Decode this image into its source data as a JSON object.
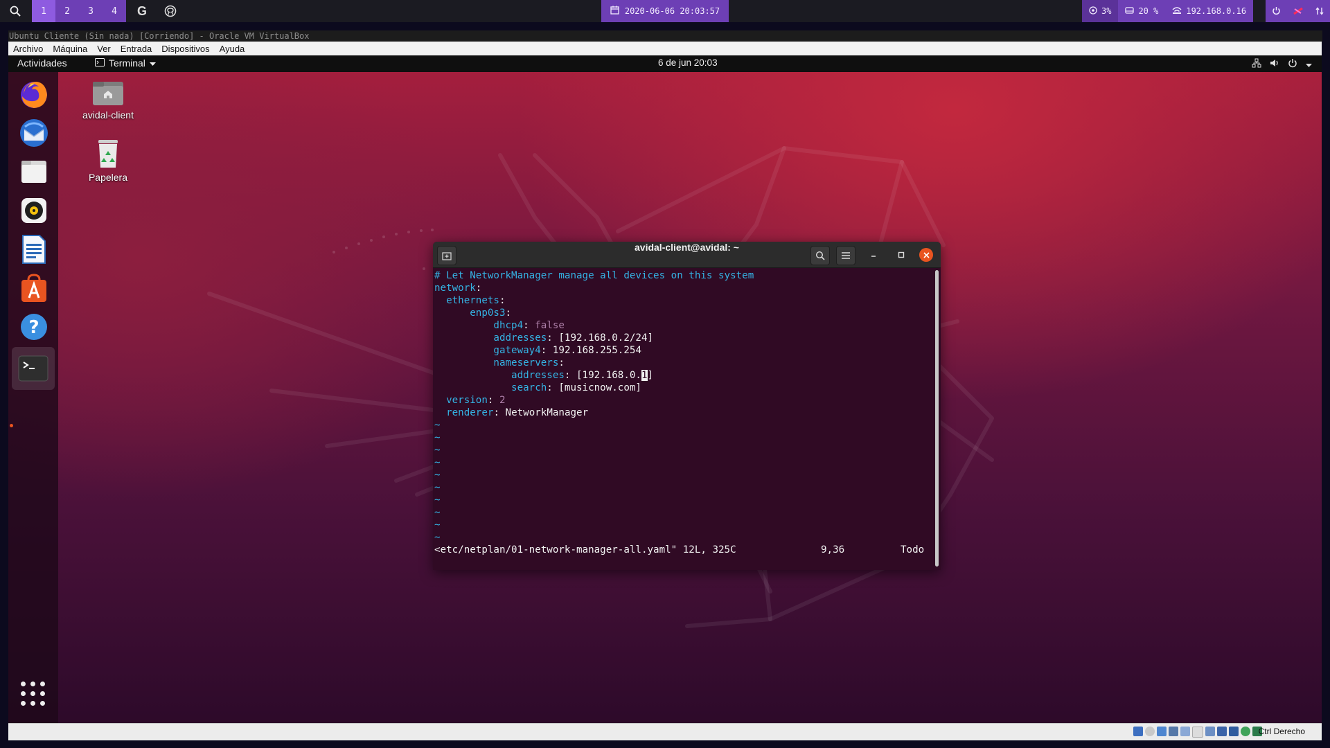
{
  "host": {
    "workspaces": [
      "1",
      "2",
      "3",
      "4"
    ],
    "active_workspace": "1",
    "datetime": "2020-06-06 20:03:57",
    "cpu": "3%",
    "disk": "20 %",
    "ip": "192.168.0.16",
    "icons": [
      "search-icon",
      "google-icon",
      "github-icon",
      "calendar-icon",
      "cpu-icon",
      "disk-icon",
      "network-icon",
      "power-icon",
      "flag-icon",
      "transfer-icon"
    ]
  },
  "vbox": {
    "title": "Ubuntu Cliente (Sin nada) [Corriendo] - Oracle VM VirtualBox",
    "menu": [
      "Archivo",
      "Máquina",
      "Ver",
      "Entrada",
      "Dispositivos",
      "Ayuda"
    ],
    "host_key": "Ctrl Derecho"
  },
  "gnome": {
    "activities": "Actividades",
    "app_menu": "Terminal",
    "clock": "6 de jun  20:03"
  },
  "desktop": {
    "icons": [
      {
        "label": "avidal-client",
        "icon": "home-folder-icon"
      },
      {
        "label": "Papelera",
        "icon": "trash-icon"
      }
    ]
  },
  "dock": {
    "apps": [
      "firefox",
      "thunderbird",
      "files",
      "rhythmbox",
      "libreoffice-writer",
      "ubuntu-software",
      "help",
      "terminal"
    ]
  },
  "terminal": {
    "title": "avidal-client@avidal: ~",
    "lines": {
      "l1": "# Let NetworkManager manage all devices on this system",
      "l2k": "network",
      "l3k": "ethernets",
      "l4k": "enp0s3",
      "l5k": "dhcp4",
      "l5v": "false",
      "l6k": "addresses",
      "l6v": "[192.168.0.2/24]",
      "l7k": "gateway4",
      "l7v": "192.168.255.254",
      "l8k": "nameservers",
      "l9k": "addresses",
      "l9v_pre": "[192.168.0.",
      "l9v_cur": "1",
      "l9v_post": "]",
      "l10k": "search",
      "l10v": "[musicnow.com]",
      "l11k": "version",
      "l11v": "2",
      "l12k": "renderer",
      "l12v": "NetworkManager"
    },
    "tilde": "~",
    "status_file": "<etc/netplan/01-network-manager-all.yaml\" 12L, 325C",
    "status_pos": "9,36",
    "status_scope": "Todo"
  }
}
